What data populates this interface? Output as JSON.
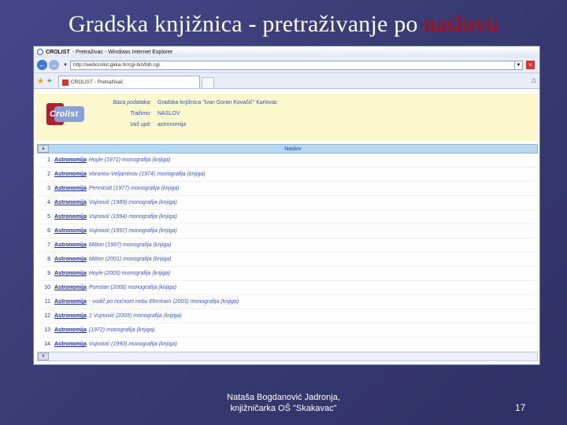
{
  "slide": {
    "title_prefix": "Gradska knjižnica - pretraživanje po ",
    "title_highlight": "naslovu",
    "author_line1": "Nataša Bogdanović Jadronja,",
    "author_line2": "knjižničarka OŠ \"Skakavac\"",
    "page_number": "17"
  },
  "browser": {
    "window_title_app": "CROLIST",
    "window_title_rest": "- Pretraživac - Windows Internet Explorer",
    "url": "http://webcrolist.gkka.hr/cgi-bin/bib.cgi",
    "tab_label": "CROLIST - Pretraživač"
  },
  "info": {
    "logo_text": "Crolist",
    "rows": [
      {
        "label": "Baza podataka:",
        "value": "Gradska knjižnica \"Ivan Goran Kovačić\" Karlovac"
      },
      {
        "label": "Tražimo:",
        "value": "NASLOV"
      },
      {
        "label": "Vaš upit:",
        "value": "astronomija"
      }
    ]
  },
  "results": {
    "column_header": "Naslov",
    "items": [
      {
        "num": "1",
        "title": "Astronomija",
        "desc": "Hoyle (1971) monografija (knjiga)"
      },
      {
        "num": "2",
        "title": "Astronomija",
        "desc": "Voronov-Veljaminov (1974) monografija (knjiga)"
      },
      {
        "num": "3",
        "title": "Astronomija",
        "desc": "Pennicott (1977) monografija (knjiga)"
      },
      {
        "num": "4",
        "title": "Astronomija",
        "desc": "Vujnović (1989) monografija (knjiga)"
      },
      {
        "num": "5",
        "title": "Astronomija",
        "desc": "Vujnović (1994) monografija (knjiga)"
      },
      {
        "num": "6",
        "title": "Astronomija",
        "desc": "Vujnović (1997) monografija (knjiga)"
      },
      {
        "num": "7",
        "title": "Astronomija",
        "desc": "Mitton (1997) monografija (knjiga)"
      },
      {
        "num": "8",
        "title": "Astronomija",
        "desc": "Mitton (2001) monografija (knjiga)"
      },
      {
        "num": "9",
        "title": "Astronomija",
        "desc": "Hoyle (2005) monografija (knjiga)"
      },
      {
        "num": "10",
        "title": "Astronomija",
        "desc": "Ponstan (2006) monografija (knjiga)"
      },
      {
        "num": "11",
        "title": "Astronomija",
        "desc": "- vodič po noćnom nebu Ekrnham (2003) monografija (knjiga)"
      },
      {
        "num": "12",
        "title": "Astronomija",
        "desc": "1 Vujnović (2005) monografija (knjiga)"
      },
      {
        "num": "13",
        "title": "Astronomija",
        "desc": "(1972) monografija (knjiga)"
      },
      {
        "num": "14",
        "title": "Astronomija",
        "desc": "Vujnović (1990) monografija (knjiga)"
      }
    ]
  }
}
